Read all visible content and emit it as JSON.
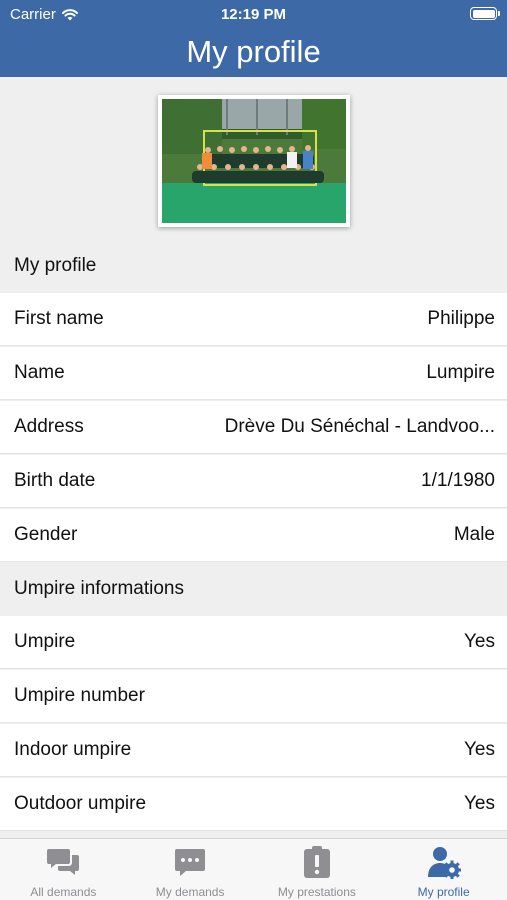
{
  "status_bar": {
    "carrier": "Carrier",
    "time": "12:19 PM"
  },
  "header": {
    "title": "My profile"
  },
  "profile_section": {
    "title": "My profile",
    "rows": [
      {
        "label": "First name",
        "value": "Philippe"
      },
      {
        "label": "Name",
        "value": "Lumpire"
      },
      {
        "label": "Address",
        "value": "Drève Du Sénéchal - Landvoo..."
      },
      {
        "label": "Birth date",
        "value": "1/1/1980"
      },
      {
        "label": "Gender",
        "value": "Male"
      }
    ]
  },
  "umpire_section": {
    "title": "Umpire informations",
    "rows": [
      {
        "label": "Umpire",
        "value": "Yes"
      },
      {
        "label": "Umpire number",
        "value": ""
      },
      {
        "label": "Indoor umpire",
        "value": "Yes"
      },
      {
        "label": "Outdoor umpire",
        "value": "Yes"
      }
    ]
  },
  "tabbar": {
    "tabs": [
      {
        "label": "All demands",
        "icon": "chat-bubbles-icon",
        "active": false
      },
      {
        "label": "My demands",
        "icon": "chat-bubble-icon",
        "active": false
      },
      {
        "label": "My prestations",
        "icon": "clipboard-alert-icon",
        "active": false
      },
      {
        "label": "My profile",
        "icon": "user-gear-icon",
        "active": true
      }
    ]
  },
  "colors": {
    "brand": "#3d6aa7",
    "inactive_tab": "#8e8e93",
    "background": "#efefef"
  }
}
